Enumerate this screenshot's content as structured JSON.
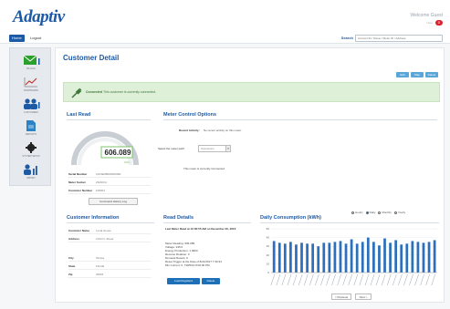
{
  "app": {
    "logo": "Adaptiv",
    "welcome": "Welcome Guest",
    "user_name": "User",
    "notif_count": "0"
  },
  "nav": {
    "home": "Home",
    "logout": "Logout",
    "search_label": "Search",
    "search_placeholder": "Account ID / Name / Meter ID / Address"
  },
  "sidebar": {
    "items": [
      {
        "label": "Billing",
        "icon": "envelope-icon",
        "color": "#2ca02c"
      },
      {
        "label": "Dashboard",
        "icon": "line-chart-icon",
        "color": "#c0392b"
      },
      {
        "label": "Customers",
        "icon": "users-icon",
        "color": "#1d5aa6"
      },
      {
        "label": "Reports",
        "icon": "document-icon",
        "color": "#2b83c6"
      },
      {
        "label": "System Setup",
        "icon": "gear-icon",
        "color": "#222222"
      },
      {
        "label": "Import",
        "icon": "bar-chart-icon",
        "color": "#1d5aa6"
      }
    ]
  },
  "page": {
    "title": "Customer Detail",
    "buttons": [
      "Edit",
      "Map",
      "Delete"
    ]
  },
  "alert": {
    "strong": "Connected",
    "text": "This customer is currently connected."
  },
  "last_read": {
    "title": "Last Read",
    "value": "606.089",
    "unit": "kWh",
    "fields": [
      {
        "k": "Serial Number",
        "v": "L9X3E3B000000001"
      },
      {
        "k": "Meter Socket",
        "v": "2S/200 A"
      },
      {
        "k": "Customer Number",
        "v": "100001"
      }
    ],
    "command_button": "Command History Log"
  },
  "meter_control": {
    "title": "Meter Control Options",
    "recent_activity_label": "Recent Activity:",
    "recent_activity_value": "No recent activity on this meter.",
    "select_label": "Select the meter path:",
    "select_value": "Operations",
    "status_text": "This meter is currently Connected."
  },
  "customer_info": {
    "title": "Customer Information",
    "rows": [
      {
        "k": "Customer Name",
        "v": "Local House"
      },
      {
        "k": "Address",
        "v": "1234 N. Street"
      },
      {
        "k": "City",
        "v": "Tampa"
      },
      {
        "k": "State",
        "v": "Florida"
      },
      {
        "k": "Zip",
        "v": "33601"
      }
    ]
  },
  "read_details": {
    "title": "Read Details",
    "heading": "Last Meter Read at 12:00:55 AM on December 20, 2016",
    "lines": [
      "Meter Reading: 606.089",
      "Voltage: 245.0",
      "Energy Production: 1.09KF",
      "Reverse Rotation: 0",
      "Demand Resets: 0",
      "Reset Trigger at the Date of 8/21/2017 7:39:34",
      "Min Current: 0, 739/5/10 8:00:00 PM"
    ],
    "buttons": [
      "Load Registers",
      "Delete"
    ]
  },
  "consumption": {
    "title": "Daily Consumption (kWh)",
    "radios": [
      "Hourly",
      "Daily",
      "Monthly",
      "Yearly"
    ],
    "selected": "Daily",
    "prev": "< Previous",
    "next": "Next >"
  },
  "chart_data": {
    "type": "bar",
    "title": "",
    "xlabel": "",
    "ylabel": "",
    "ylim": [
      0,
      50
    ],
    "y_ticks": [
      "50",
      "40",
      "30",
      "20",
      "10",
      "0"
    ],
    "values": [
      36,
      34,
      33,
      35,
      32,
      34,
      33,
      33,
      30,
      34,
      34,
      35,
      36,
      33,
      38,
      33,
      35,
      40,
      35,
      31,
      39,
      34,
      37,
      32,
      33,
      36,
      35,
      34,
      35,
      37
    ],
    "color": "#2c6fbb"
  }
}
